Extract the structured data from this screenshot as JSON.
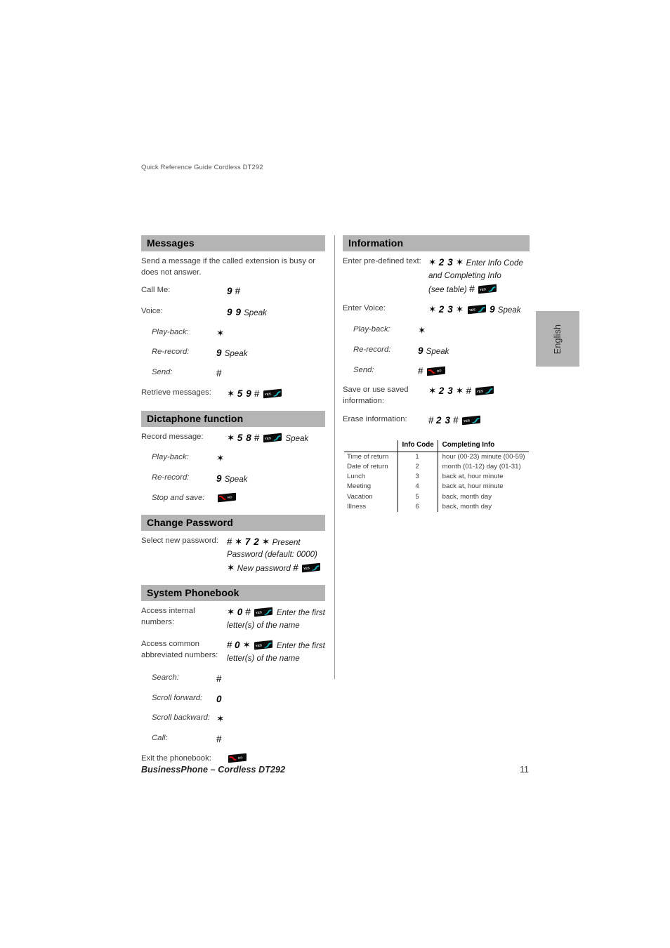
{
  "document": {
    "running_head": "Quick Reference Guide Cordless DT292",
    "footer_title": "BusinessPhone – Cordless DT292",
    "page_number": "11",
    "language_tab": "English",
    "header_bg": "#b4b4b4"
  },
  "icons": {
    "yes_label": "YES",
    "no_label": "NO",
    "yes_hook_color": "#14b6c4",
    "no_hook_color": "#e1100f"
  },
  "left_column": {
    "messages": {
      "heading": "Messages",
      "intro": "Send a message if the called extension is busy or does not answer.",
      "rows": [
        {
          "label": "Call Me:",
          "indent": false,
          "parts": [
            {
              "t": "k",
              "v": "9"
            },
            {
              "t": "sym",
              "v": "#"
            }
          ]
        },
        {
          "label": "Voice:",
          "indent": false,
          "parts": [
            {
              "t": "k",
              "v": "9 9"
            },
            {
              "t": "it",
              "v": "Speak"
            }
          ]
        },
        {
          "label": "Play-back:",
          "indent": true,
          "parts": [
            {
              "t": "sym",
              "v": "✶"
            }
          ]
        },
        {
          "label": "Re-record:",
          "indent": true,
          "parts": [
            {
              "t": "k",
              "v": "9"
            },
            {
              "t": "it",
              "v": "Speak"
            }
          ]
        },
        {
          "label": "Send:",
          "indent": true,
          "parts": [
            {
              "t": "sym",
              "v": "#"
            }
          ]
        },
        {
          "label": "Retrieve messages:",
          "indent": false,
          "parts": [
            {
              "t": "sym",
              "v": "✶"
            },
            {
              "t": "k",
              "v": "5 9"
            },
            {
              "t": "sym",
              "v": "#"
            },
            {
              "t": "icon",
              "v": "yes"
            }
          ]
        }
      ]
    },
    "dictaphone": {
      "heading": "Dictaphone function",
      "rows": [
        {
          "label": "Record message:",
          "indent": false,
          "parts": [
            {
              "t": "sym",
              "v": "✶"
            },
            {
              "t": "k",
              "v": "5 8"
            },
            {
              "t": "sym",
              "v": "#"
            },
            {
              "t": "icon",
              "v": "yes"
            },
            {
              "t": "it",
              "v": "Speak"
            }
          ]
        },
        {
          "label": "Play-back:",
          "indent": true,
          "parts": [
            {
              "t": "sym",
              "v": "✶"
            }
          ]
        },
        {
          "label": "Re-record:",
          "indent": true,
          "parts": [
            {
              "t": "k",
              "v": "9"
            },
            {
              "t": "it",
              "v": "Speak"
            }
          ]
        },
        {
          "label": "Stop and save:",
          "indent": true,
          "parts": [
            {
              "t": "icon",
              "v": "no"
            }
          ]
        }
      ]
    },
    "change_password": {
      "heading": "Change Password",
      "rows": [
        {
          "label": "Select new password:",
          "indent": false,
          "lines": [
            [
              {
                "t": "sym",
                "v": "#"
              },
              {
                "t": "sym",
                "v": "✶"
              },
              {
                "t": "k",
                "v": "7 2"
              },
              {
                "t": "sym",
                "v": "✶"
              },
              {
                "t": "it",
                "v": "Present"
              }
            ],
            [
              {
                "t": "it",
                "v": "Password (default: 0000)"
              }
            ],
            [
              {
                "t": "sym",
                "v": "✶"
              },
              {
                "t": "it",
                "v": "New password"
              },
              {
                "t": "sym",
                "v": "#"
              },
              {
                "t": "icon",
                "v": "yes"
              }
            ]
          ]
        }
      ]
    },
    "system_phonebook": {
      "heading": "System Phonebook",
      "rows": [
        {
          "label": "Access internal numbers:",
          "indent": false,
          "lines": [
            [
              {
                "t": "sym",
                "v": "✶"
              },
              {
                "t": "k",
                "v": "0"
              },
              {
                "t": "sym",
                "v": "#"
              },
              {
                "t": "icon",
                "v": "yes"
              },
              {
                "t": "it",
                "v": "Enter the first"
              }
            ],
            [
              {
                "t": "it",
                "v": "letter(s) of the name"
              }
            ]
          ]
        },
        {
          "label": "Access common abbreviated numbers:",
          "indent": false,
          "lines": [
            [
              {
                "t": "sym",
                "v": "#"
              },
              {
                "t": "k",
                "v": "0"
              },
              {
                "t": "sym",
                "v": "✶"
              },
              {
                "t": "icon",
                "v": "yes"
              },
              {
                "t": "it",
                "v": "Enter the first"
              }
            ],
            [
              {
                "t": "it",
                "v": "letter(s) of the name"
              }
            ]
          ]
        },
        {
          "label": "Search:",
          "indent": true,
          "parts": [
            {
              "t": "sym",
              "v": "#"
            }
          ]
        },
        {
          "label": "Scroll forward:",
          "indent": true,
          "parts": [
            {
              "t": "k",
              "v": "0"
            }
          ]
        },
        {
          "label": "Scroll backward:",
          "indent": true,
          "parts": [
            {
              "t": "sym",
              "v": "✶"
            }
          ]
        },
        {
          "label": "Call:",
          "indent": true,
          "parts": [
            {
              "t": "sym",
              "v": "#"
            }
          ]
        },
        {
          "label": "Exit the phonebook:",
          "indent": false,
          "parts": [
            {
              "t": "icon",
              "v": "no"
            }
          ]
        }
      ]
    }
  },
  "right_column": {
    "information": {
      "heading": "Information",
      "rows": [
        {
          "label": "Enter pre-defined text:",
          "indent": false,
          "lines": [
            [
              {
                "t": "sym",
                "v": "✶"
              },
              {
                "t": "k",
                "v": "2 3"
              },
              {
                "t": "sym",
                "v": "✶"
              },
              {
                "t": "it",
                "v": "Enter Info Code"
              }
            ],
            [
              {
                "t": "it",
                "v": "and  Completing Info"
              }
            ],
            [
              {
                "t": "it",
                "v": "(see table)"
              },
              {
                "t": "sym",
                "v": "#"
              },
              {
                "t": "icon",
                "v": "yes"
              }
            ]
          ]
        },
        {
          "label": "Enter Voice:",
          "indent": false,
          "parts": [
            {
              "t": "sym",
              "v": "✶"
            },
            {
              "t": "k",
              "v": "2 3"
            },
            {
              "t": "sym",
              "v": "✶"
            },
            {
              "t": "icon",
              "v": "yes"
            },
            {
              "t": "k",
              "v": "9"
            },
            {
              "t": "it",
              "v": "Speak"
            }
          ]
        },
        {
          "label": "Play-back:",
          "indent": true,
          "parts": [
            {
              "t": "sym",
              "v": "✶"
            }
          ]
        },
        {
          "label": "Re-record:",
          "indent": true,
          "parts": [
            {
              "t": "k",
              "v": "9"
            },
            {
              "t": "it",
              "v": "Speak"
            }
          ]
        },
        {
          "label": "Send:",
          "indent": true,
          "parts": [
            {
              "t": "sym",
              "v": "#"
            },
            {
              "t": "icon",
              "v": "no"
            }
          ]
        },
        {
          "label": "Save or use saved information:",
          "indent": false,
          "parts": [
            {
              "t": "sym",
              "v": "✶"
            },
            {
              "t": "k",
              "v": "2 3"
            },
            {
              "t": "sym",
              "v": "✶"
            },
            {
              "t": "sym",
              "v": "#"
            },
            {
              "t": "icon",
              "v": "yes"
            }
          ],
          "label_baseline": 2
        },
        {
          "label": "Erase information:",
          "indent": false,
          "parts": [
            {
              "t": "sym",
              "v": "#"
            },
            {
              "t": "k",
              "v": "2 3"
            },
            {
              "t": "sym",
              "v": "#"
            },
            {
              "t": "icon",
              "v": "yes"
            }
          ]
        }
      ],
      "table": {
        "columns": [
          "",
          "Info Code",
          "Completing Info"
        ],
        "rows": [
          [
            "Time of return",
            "1",
            "hour (00-23) minute (00-59)"
          ],
          [
            "Date of return",
            "2",
            "month (01-12) day (01-31)"
          ],
          [
            "Lunch",
            "3",
            "back at, hour minute"
          ],
          [
            "Meeting",
            "4",
            "back at, hour minute"
          ],
          [
            "Vacation",
            "5",
            "back, month day"
          ],
          [
            "Illness",
            "6",
            "back, month day"
          ]
        ]
      }
    }
  }
}
